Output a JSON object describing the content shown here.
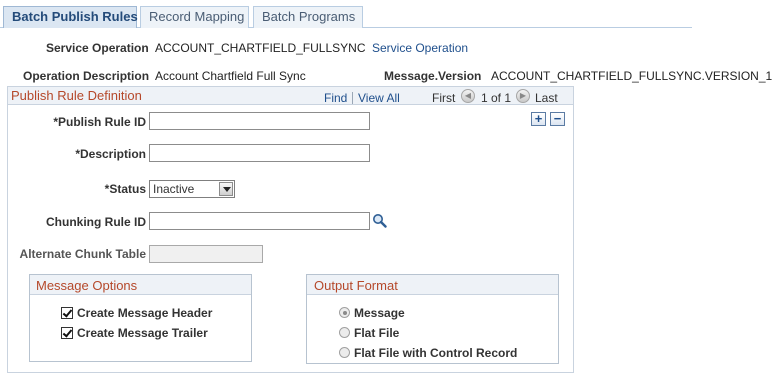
{
  "tabs": [
    {
      "label": "Batch Publish Rules",
      "active": true
    },
    {
      "label": "Record Mapping",
      "active": false
    },
    {
      "label": "Batch Programs",
      "active": false
    }
  ],
  "header": {
    "service_operation_label": "Service Operation",
    "service_operation_value": "ACCOUNT_CHARTFIELD_FULLSYNC",
    "service_operation_link": "Service Operation",
    "operation_description_label": "Operation Description",
    "operation_description_value": "Account Chartfield Full Sync",
    "message_version_label": "Message.Version",
    "message_version_value": "ACCOUNT_CHARTFIELD_FULLSYNC.VERSION_1"
  },
  "group": {
    "title": "Publish Rule Definition",
    "find": "Find",
    "view_all": "View All",
    "first": "First",
    "page_info": "1 of 1",
    "last": "Last",
    "add_symbol": "+",
    "delete_symbol": "−"
  },
  "form": {
    "publish_rule_id_label": "*Publish Rule ID",
    "publish_rule_id_value": "",
    "description_label": "*Description",
    "description_value": "",
    "status_label": "*Status",
    "status_value": "Inactive",
    "chunking_rule_id_label": "Chunking Rule ID",
    "chunking_rule_id_value": "",
    "alternate_chunk_table_label": "Alternate Chunk Table",
    "alternate_chunk_table_value": ""
  },
  "message_options": {
    "title": "Message Options",
    "items": [
      {
        "label": "Create Message Header",
        "checked": true
      },
      {
        "label": "Create Message Trailer",
        "checked": true
      }
    ]
  },
  "output_format": {
    "title": "Output Format",
    "options": [
      {
        "label": "Message",
        "selected": true
      },
      {
        "label": "Flat File",
        "selected": false
      },
      {
        "label": "Flat File with Control Record",
        "selected": false
      }
    ]
  },
  "icons": {
    "lookup": "magnifier-icon",
    "prev": "arrow-left-icon",
    "next": "arrow-right-icon"
  }
}
